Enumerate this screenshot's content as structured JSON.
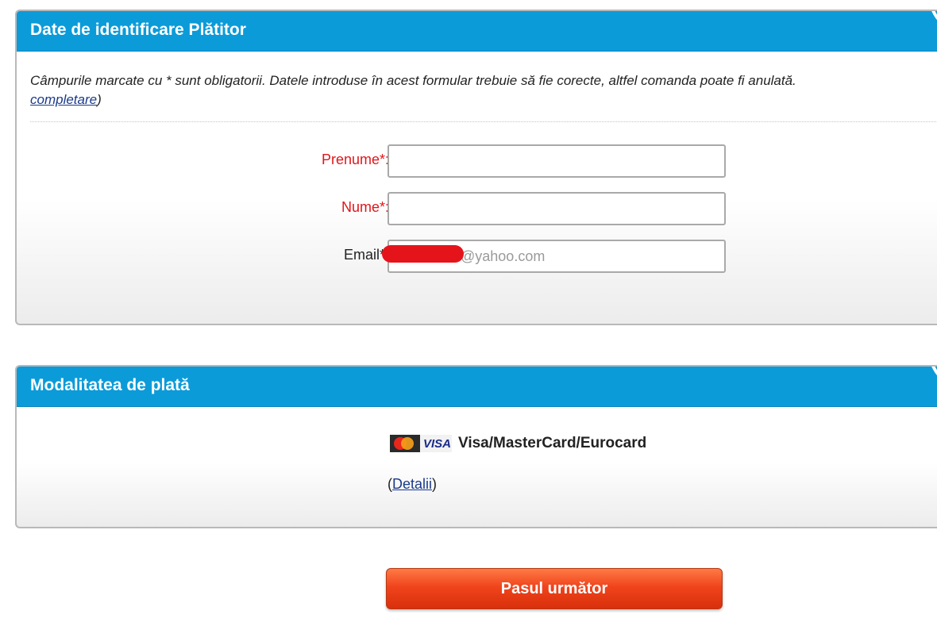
{
  "payer_section": {
    "title": "Date de identificare Plătitor",
    "notice_text": "Câmpurile marcate cu * sunt obligatorii. Datele introduse în acest formular trebuie să fie corecte, altfel comanda poate fi anulată.",
    "notice_link": "completare",
    "notice_link_close": ")",
    "fields": {
      "first_name": {
        "label": "Prenume*:",
        "value": ""
      },
      "last_name": {
        "label": "Nume*:",
        "value": ""
      },
      "email": {
        "label": "Email*:",
        "value": "@yahoo.com"
      }
    }
  },
  "payment_section": {
    "title": "Modalitatea de plată",
    "option_label": "Visa/MasterCard/Eurocard",
    "card_brand_text": "VISA",
    "details_open": "(",
    "details_link": "Detalii",
    "details_close": ")"
  },
  "next_button": {
    "label": "Pasul următor"
  },
  "colors": {
    "header_blue": "#0b9bd9",
    "required_red": "#e0161b",
    "button_orange": "#f0441c"
  }
}
